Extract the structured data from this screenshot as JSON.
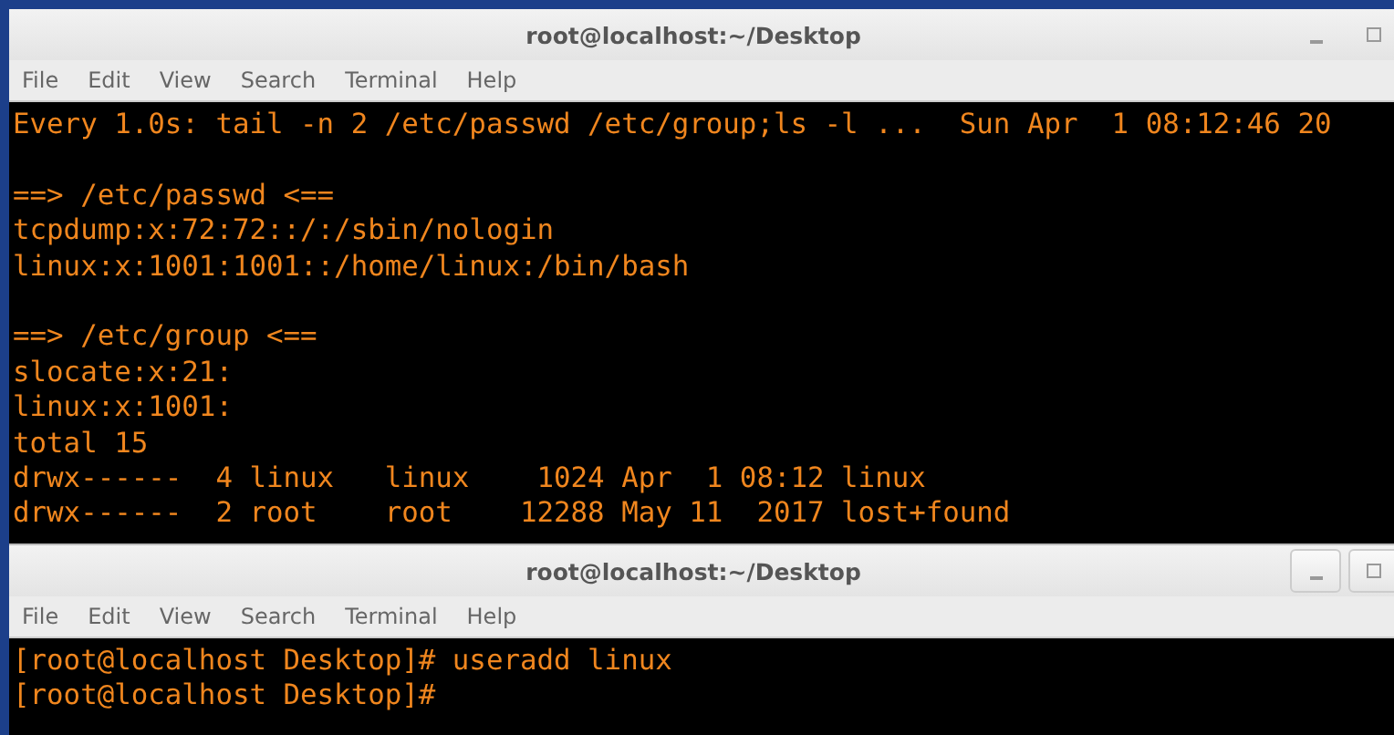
{
  "windows": [
    {
      "title": "root@localhost:~/Desktop",
      "menu": [
        "File",
        "Edit",
        "View",
        "Search",
        "Terminal",
        "Help"
      ],
      "blocks": [
        [
          "Every 1.0s: tail -n 2 /etc/passwd /etc/group;ls -l ...  Sun Apr  1 08:12:46 20"
        ],
        [
          "==> /etc/passwd <==",
          "tcpdump:x:72:72::/:/sbin/nologin",
          "linux:x:1001:1001::/home/linux:/bin/bash"
        ],
        [
          "==> /etc/group <==",
          "slocate:x:21:",
          "linux:x:1001:",
          "total 15",
          "drwx------  4 linux   linux    1024 Apr  1 08:12 linux",
          "drwx------  2 root    root    12288 May 11  2017 lost+found"
        ]
      ]
    },
    {
      "title": "root@localhost:~/Desktop",
      "menu": [
        "File",
        "Edit",
        "View",
        "Search",
        "Terminal",
        "Help"
      ],
      "blocks": [
        [
          "[root@localhost Desktop]# useradd linux",
          "[root@localhost Desktop]#"
        ]
      ]
    }
  ]
}
